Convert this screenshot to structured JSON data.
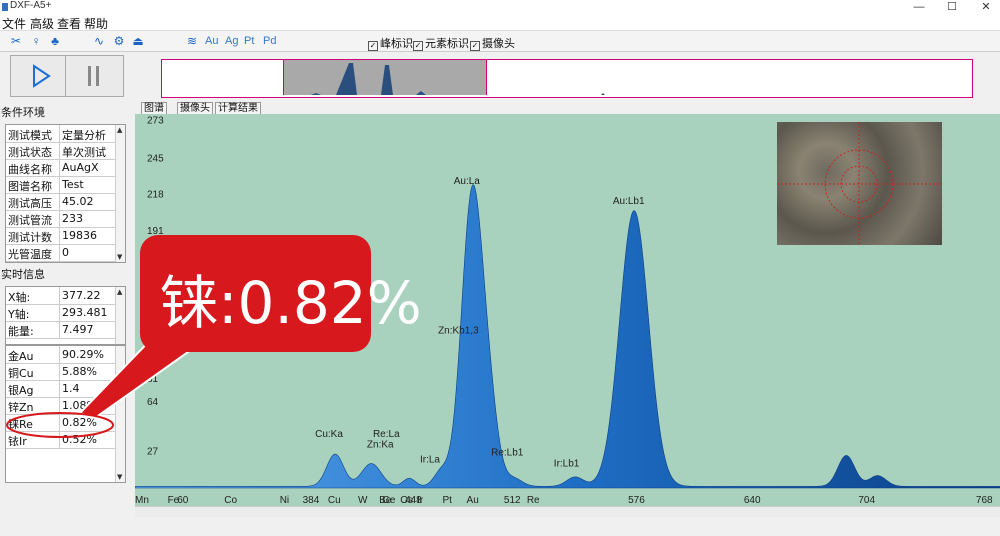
{
  "window": {
    "title": "DXF-A5+",
    "minimize": "—",
    "maximize": "☐",
    "close": "✕"
  },
  "menu": [
    {
      "label": "文件"
    },
    {
      "label": "高级"
    },
    {
      "label": "查看"
    },
    {
      "label": "帮助"
    }
  ],
  "toolbar": {
    "element_buttons": [
      "Au",
      "Ag",
      "Pt",
      "Pd"
    ],
    "checks": [
      {
        "label": "峰标识",
        "checked": true
      },
      {
        "label": "元素标识",
        "checked": true
      },
      {
        "label": "摄像头",
        "checked": true
      }
    ]
  },
  "conditions": {
    "title": "条件环境",
    "rows": [
      {
        "k": "测试模式",
        "v": "定量分析"
      },
      {
        "k": "测试状态",
        "v": "单次测试"
      },
      {
        "k": "曲线名称",
        "v": "AuAgX"
      },
      {
        "k": "图谱名称",
        "v": "Test"
      },
      {
        "k": "测试高压",
        "v": "45.02"
      },
      {
        "k": "测试管流",
        "v": "233"
      },
      {
        "k": "测试计数",
        "v": "19836"
      },
      {
        "k": "光管温度",
        "v": "0"
      }
    ]
  },
  "realtime": {
    "title": "实时信息",
    "rows": [
      {
        "k": "X轴:",
        "v": "377.22"
      },
      {
        "k": "Y轴:",
        "v": "293.481"
      },
      {
        "k": "能量:",
        "v": "7.497"
      }
    ]
  },
  "results": {
    "rows": [
      {
        "k": "金Au",
        "v": "90.29%"
      },
      {
        "k": "铜Cu",
        "v": "5.88%"
      },
      {
        "k": "银Ag",
        "v": "1.4"
      },
      {
        "k": "锌Zn",
        "v": "1.08%"
      },
      {
        "k": "铼Re",
        "v": "0.82%"
      },
      {
        "k": "铱Ir",
        "v": "0.52%"
      }
    ]
  },
  "tabs": [
    "图谱",
    "摄像头",
    "计算结果"
  ],
  "callout": {
    "text": "铼:0.82%"
  },
  "chart_data": {
    "type": "area",
    "x_ticks": [
      {
        "x": 0,
        "label": "Mn"
      },
      {
        "x": 64,
        "label": "Fe"
      },
      {
        "x": 80,
        "label": "60"
      },
      {
        "x": 158,
        "label": "Co"
      },
      {
        "x": 250,
        "label": "Ni"
      },
      {
        "x": 288,
        "label": "384"
      },
      {
        "x": 330,
        "label": "Cu"
      },
      {
        "x": 380,
        "label": "W"
      },
      {
        "x": 415,
        "label": "Be"
      },
      {
        "x": 420,
        "label": "Ge"
      },
      {
        "x": 450,
        "label": "Os"
      },
      {
        "x": 458,
        "label": "448"
      },
      {
        "x": 478,
        "label": "Ir"
      },
      {
        "x": 520,
        "label": "Pt"
      },
      {
        "x": 560,
        "label": "Au"
      },
      {
        "x": 622,
        "label": "512"
      },
      {
        "x": 660,
        "label": "Re"
      },
      {
        "x": 828,
        "label": "576"
      },
      {
        "x": 1020,
        "label": "640"
      },
      {
        "x": 1210,
        "label": "704"
      },
      {
        "x": 1405,
        "label": "768"
      }
    ],
    "y_ticks": [
      27,
      54,
      81,
      108,
      135,
      162,
      189,
      216,
      243,
      270
    ],
    "y_tick_labels": [
      {
        "y": 27,
        "label": "27"
      },
      {
        "y": 64,
        "label": "64"
      },
      {
        "y": 81,
        "label": "81"
      },
      {
        "y": 191,
        "label": "191"
      },
      {
        "y": 218,
        "label": "218"
      },
      {
        "y": 245,
        "label": "245"
      },
      {
        "y": 273,
        "label": "273"
      }
    ],
    "xlim": [
      0,
      1435
    ],
    "ylim": [
      0,
      275
    ],
    "peaks": [
      {
        "x": 332,
        "h": 24,
        "w": 14
      },
      {
        "x": 392,
        "h": 17,
        "w": 16
      },
      {
        "x": 455,
        "h": 6,
        "w": 10
      },
      {
        "x": 508,
        "h": 11,
        "w": 12
      },
      {
        "x": 560,
        "h": 220,
        "w": 18
      },
      {
        "x": 590,
        "h": 40,
        "w": 14
      },
      {
        "x": 628,
        "h": 6,
        "w": 14
      },
      {
        "x": 730,
        "h": 7,
        "w": 14
      },
      {
        "x": 828,
        "h": 205,
        "w": 24
      },
      {
        "x": 1180,
        "h": 23,
        "w": 14
      },
      {
        "x": 1232,
        "h": 8,
        "w": 14
      }
    ],
    "annotations": [
      {
        "x": 322,
        "y": 38,
        "label": "Cu:Ka"
      },
      {
        "x": 418,
        "y": 38,
        "label": "Re:La"
      },
      {
        "x": 408,
        "y": 30,
        "label": "Zn:Ka"
      },
      {
        "x": 496,
        "y": 19,
        "label": "Ir:La"
      },
      {
        "x": 552,
        "y": 226,
        "label": "Au:La"
      },
      {
        "x": 526,
        "y": 115,
        "label": "Zn:Kb1,3"
      },
      {
        "x": 614,
        "y": 24,
        "label": "Re:Lb1"
      },
      {
        "x": 718,
        "y": 16,
        "label": "Ir:Lb1"
      },
      {
        "x": 816,
        "y": 211,
        "label": "Au:Lb1"
      }
    ]
  }
}
